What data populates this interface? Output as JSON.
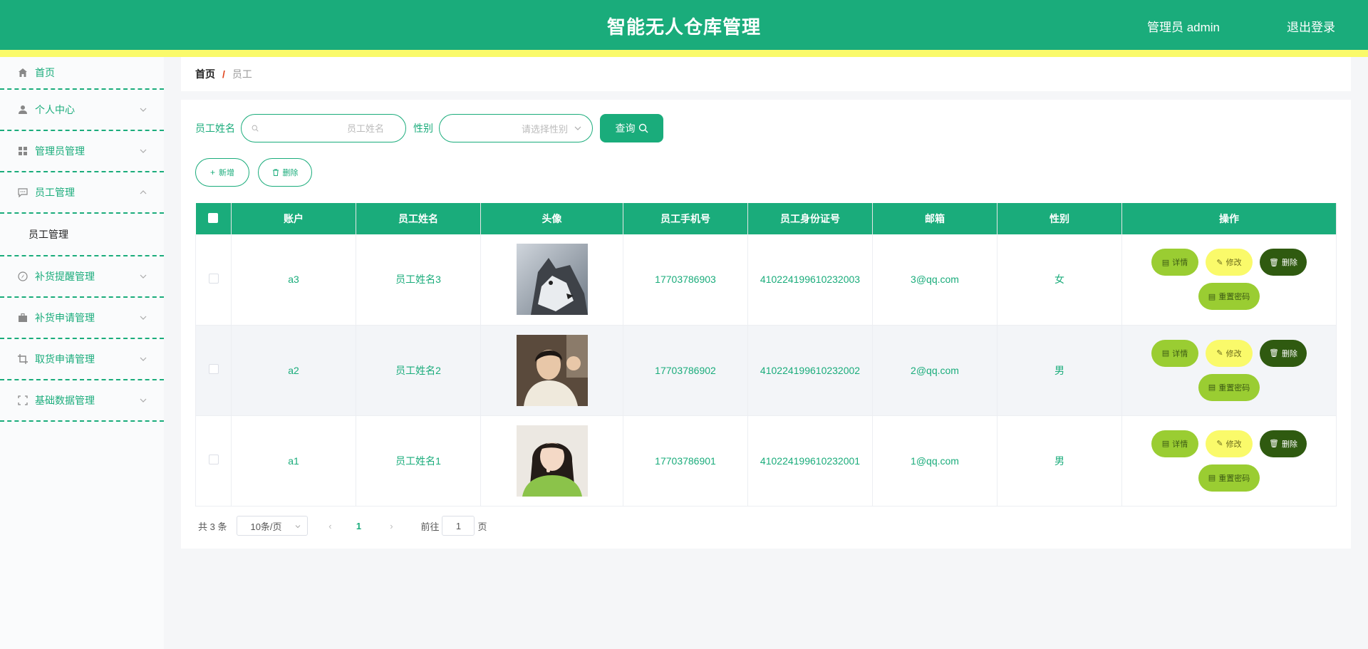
{
  "header": {
    "title": "智能无人仓库管理",
    "user": "管理员 admin",
    "logout": "退出登录"
  },
  "sidebar": {
    "items": [
      {
        "label": "首页",
        "icon": "home-icon"
      },
      {
        "label": "个人中心",
        "icon": "user-icon"
      },
      {
        "label": "管理员管理",
        "icon": "grid-icon"
      },
      {
        "label": "员工管理",
        "icon": "chat-icon",
        "expanded": true,
        "children": [
          {
            "label": "员工管理"
          }
        ]
      },
      {
        "label": "补货提醒管理",
        "icon": "compass-icon"
      },
      {
        "label": "补货申请管理",
        "icon": "briefcase-icon"
      },
      {
        "label": "取货申请管理",
        "icon": "crop-icon"
      },
      {
        "label": "基础数据管理",
        "icon": "fullscreen-icon"
      }
    ]
  },
  "breadcrumb": {
    "home": "首页",
    "separator": "/",
    "current": "员工"
  },
  "search": {
    "name_label": "员工姓名",
    "name_placeholder": "员工姓名",
    "name_value": "",
    "gender_label": "性别",
    "gender_placeholder": "请选择性别",
    "query_button": "查询"
  },
  "actions": {
    "add": "新增",
    "delete": "删除"
  },
  "table": {
    "columns": [
      "账户",
      "员工姓名",
      "头像",
      "员工手机号",
      "员工身份证号",
      "邮箱",
      "性别",
      "操作"
    ],
    "rows": [
      {
        "account": "a3",
        "name": "员工姓名3",
        "avatar": "husky-dog-photo",
        "phone": "17703786903",
        "id_number": "410224199610232003",
        "email": "3@qq.com",
        "gender": "女"
      },
      {
        "account": "a2",
        "name": "员工姓名2",
        "avatar": "young-man-photo",
        "phone": "17703786902",
        "id_number": "410224199610232002",
        "email": "2@qq.com",
        "gender": "男"
      },
      {
        "account": "a1",
        "name": "员工姓名1",
        "avatar": "young-woman-photo",
        "phone": "17703786901",
        "id_number": "410224199610232001",
        "email": "1@qq.com",
        "gender": "男"
      }
    ],
    "row_actions": {
      "detail": "详情",
      "edit": "修改",
      "delete": "删除",
      "reset": "重置密码"
    }
  },
  "pagination": {
    "total": "共 3 条",
    "page_size": "10条/页",
    "current_page": "1",
    "goto_prefix": "前往",
    "goto_value": "1",
    "goto_suffix": "页"
  },
  "colors": {
    "primary": "#1aac7b",
    "strip": "#fafa6a",
    "detail_btn": "#9acd32",
    "edit_btn": "#fafa6a",
    "delete_btn": "#2f5a10",
    "breadcrumb_sep": "#e0421b"
  }
}
